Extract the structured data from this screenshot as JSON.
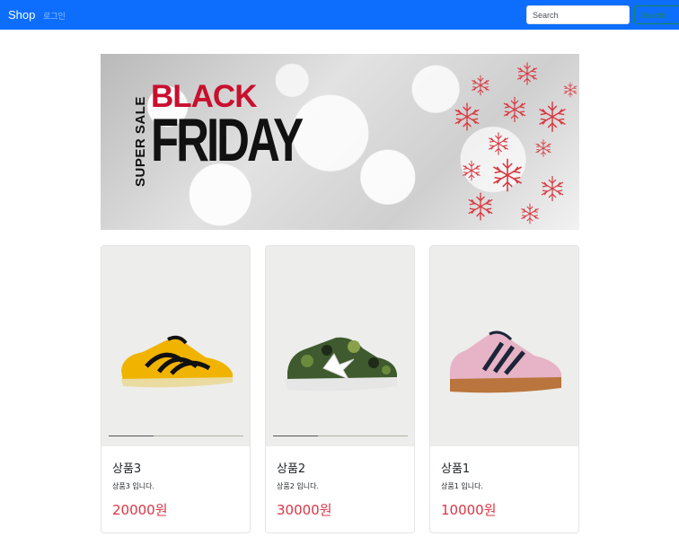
{
  "navbar": {
    "brand": "Shop",
    "login_link": "로그인",
    "search_placeholder": "Search",
    "search_button": "Search"
  },
  "banner": {
    "sub": "SUPER SALE",
    "headline_top": "BLACK",
    "headline_bottom": "FRIDAY"
  },
  "products": [
    {
      "title": "상품3",
      "desc": "상품3 입니다.",
      "price": "20000원",
      "image": "yellow-black-sneaker"
    },
    {
      "title": "상품2",
      "desc": "상품2 입니다.",
      "price": "30000원",
      "image": "camo-star-sneaker"
    },
    {
      "title": "상품1",
      "desc": "상품1 입니다.",
      "price": "10000원",
      "image": "pink-three-stripe-sneaker"
    }
  ],
  "colors": {
    "navbar": "#0d6efd",
    "search_button": "#198754",
    "price": "#dc3545",
    "banner_accent": "#c8102e"
  }
}
